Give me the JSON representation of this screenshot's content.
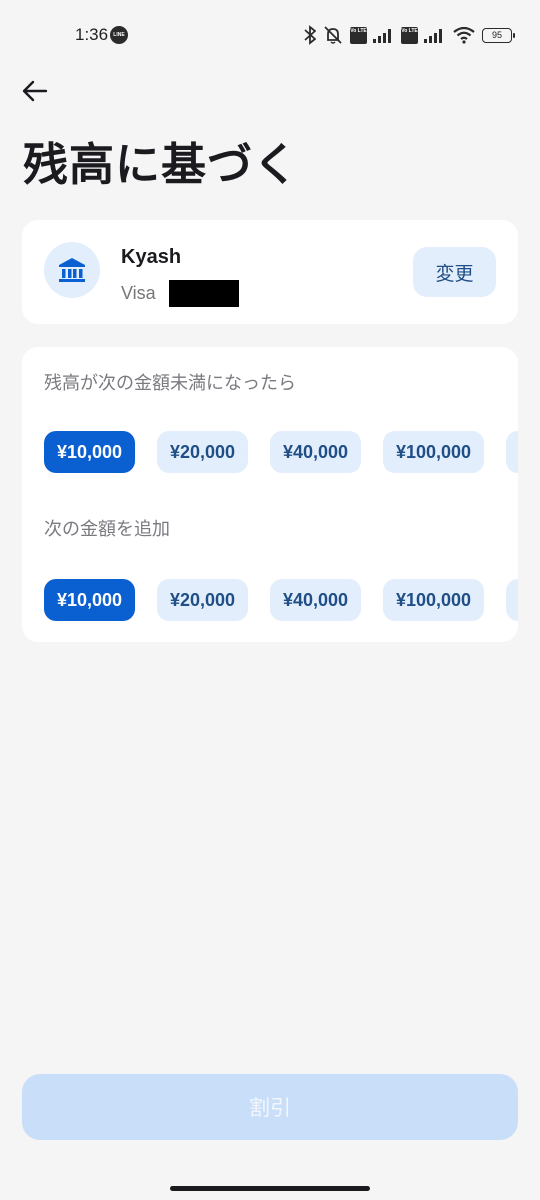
{
  "status_bar": {
    "time": "1:36",
    "line_badge": "LINE",
    "volte_label": "Vo LTE",
    "battery": "95"
  },
  "header": {
    "title": "残高に基づく"
  },
  "account": {
    "name": "Kyash",
    "network": "Visa",
    "change_label": "変更"
  },
  "threshold": {
    "label": "残高が次の金額未満になったら",
    "options": [
      "¥10,000",
      "¥20,000",
      "¥40,000",
      "¥100,000"
    ],
    "selected": "¥10,000"
  },
  "topup": {
    "label": "次の金額を追加",
    "options": [
      "¥10,000",
      "¥20,000",
      "¥40,000",
      "¥100,000"
    ],
    "selected": "¥10,000"
  },
  "footer": {
    "submit_label": "割引"
  },
  "colors": {
    "accent": "#0a5fd1",
    "chip_bg": "#e3eefc",
    "chip_text": "#1f4f86",
    "disabled_button": "#c9def8",
    "background": "#f5f5f6"
  },
  "icons": [
    "back-arrow-icon",
    "bank-icon",
    "bluetooth-icon",
    "mute-icon",
    "signal-icon",
    "wifi-icon",
    "battery-icon"
  ]
}
